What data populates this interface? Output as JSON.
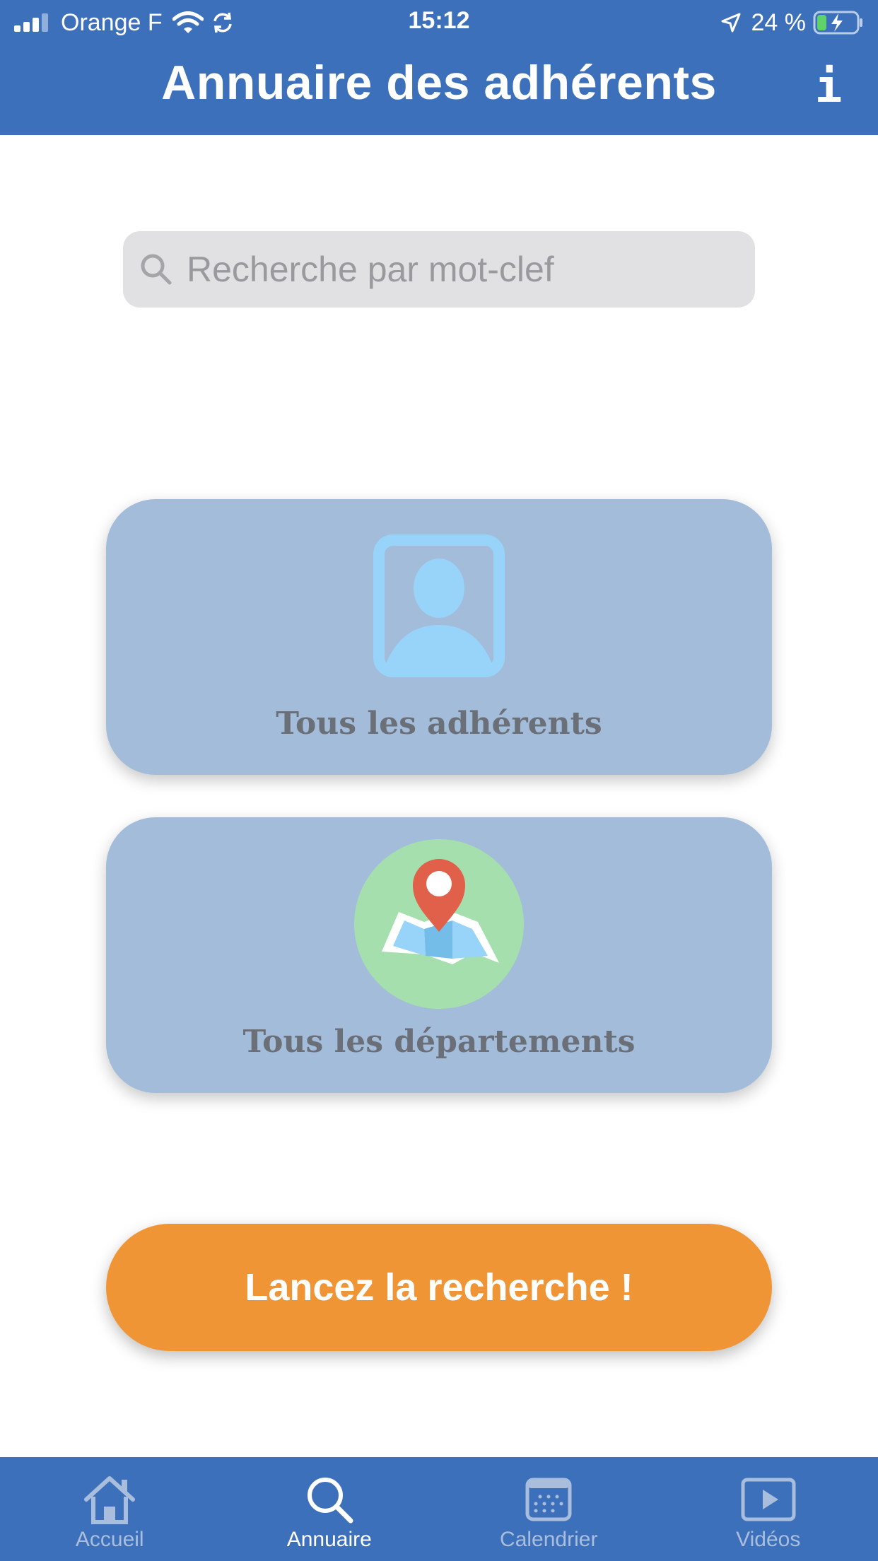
{
  "status_bar": {
    "carrier": "Orange F",
    "time": "15:12",
    "battery_percent": "24 %",
    "battery_level": 0.24
  },
  "header": {
    "title": "Annuaire des adhérents",
    "info_label": "i"
  },
  "search": {
    "placeholder": "Recherche par mot-clef",
    "value": ""
  },
  "cards": [
    {
      "label": "Tous les adhérents",
      "icon": "contact-portrait-icon"
    },
    {
      "label": "Tous les départements",
      "icon": "map-pin-icon"
    }
  ],
  "cta": {
    "label": "Lancez la recherche !"
  },
  "tabs": [
    {
      "label": "Accueil",
      "icon": "home-icon",
      "active": false
    },
    {
      "label": "Annuaire",
      "icon": "search-icon",
      "active": true
    },
    {
      "label": "Calendrier",
      "icon": "calendar-icon",
      "active": false
    },
    {
      "label": "Vidéos",
      "icon": "play-icon",
      "active": false
    }
  ],
  "colors": {
    "header": "#3d70bb",
    "card": "#a2bcda",
    "cta": "#f09535",
    "pin": "#e0604a",
    "map_circle": "#a6dfae",
    "portrait": "#98d4fa"
  }
}
